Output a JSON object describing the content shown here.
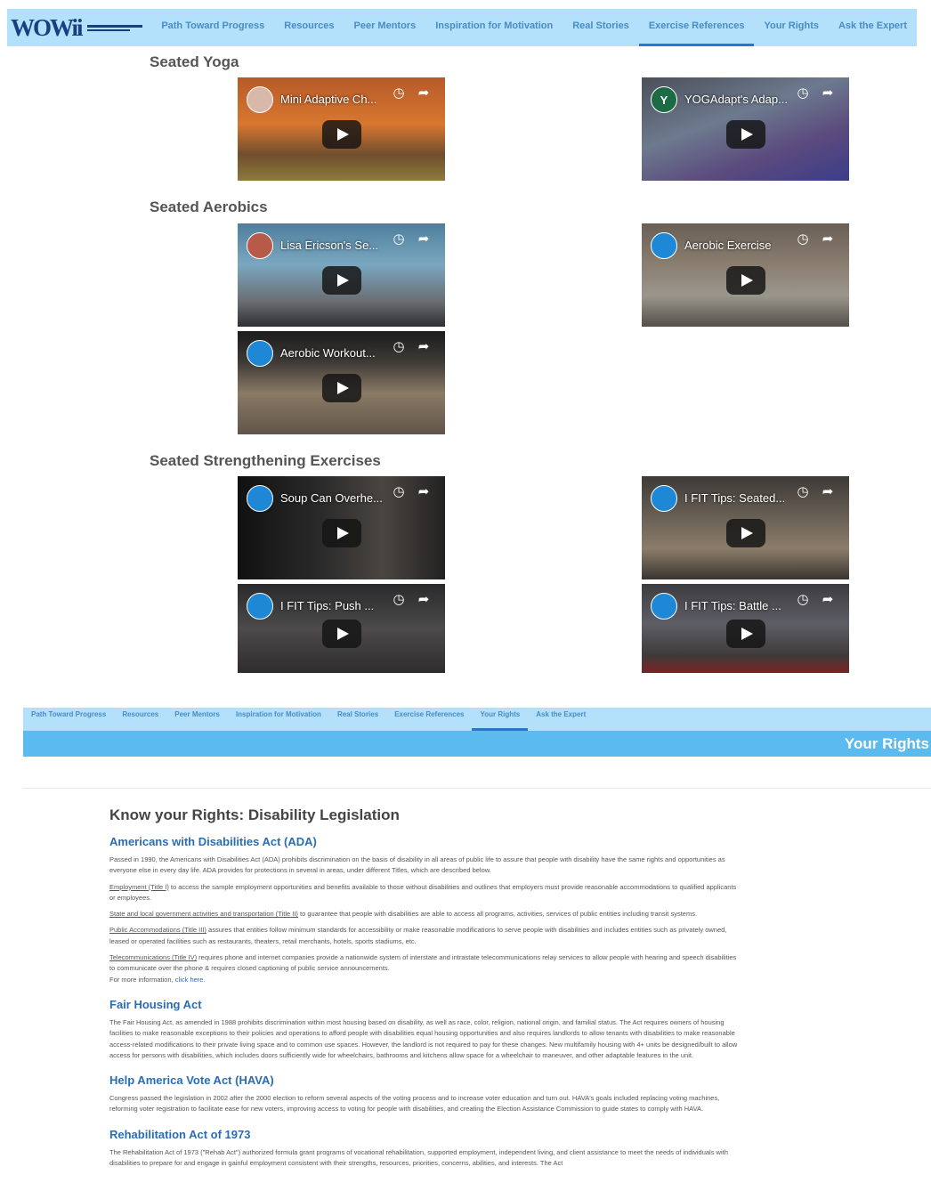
{
  "nav": {
    "logo_text": "WOWii",
    "items": [
      {
        "label": "Path Toward Progress"
      },
      {
        "label": "Resources"
      },
      {
        "label": "Peer Mentors"
      },
      {
        "label": "Inspiration for Motivation"
      },
      {
        "label": "Real Stories"
      },
      {
        "label": "Exercise References"
      },
      {
        "label": "Your Rights"
      },
      {
        "label": "Ask the Expert"
      }
    ],
    "active": "Exercise References"
  },
  "sections": {
    "yoga": {
      "title": "Seated Yoga"
    },
    "aerobics": {
      "title": "Seated Aerobics"
    },
    "strength": {
      "title": "Seated Strengthening Exercises"
    }
  },
  "videos": {
    "yoga_1": {
      "title": "Mini Adaptive Ch...",
      "avatar": ""
    },
    "yoga_2": {
      "title": "YOGAdapt's Adap...",
      "avatar": "Y"
    },
    "aero_1": {
      "title": "Lisa Ericson's Se...",
      "avatar": ""
    },
    "aero_2": {
      "title": "Aerobic Exercise",
      "avatar": ""
    },
    "aero_3": {
      "title": "Aerobic Workout...",
      "avatar": ""
    },
    "str_1": {
      "title": "Soup Can Overhe...",
      "avatar": ""
    },
    "str_2": {
      "title": "I FIT Tips: Seated...",
      "avatar": ""
    },
    "str_3": {
      "title": "I FIT Tips: Push ...",
      "avatar": ""
    },
    "str_4": {
      "title": "I FIT Tips: Battle ...",
      "avatar": ""
    }
  },
  "subnav": {
    "items": [
      {
        "label": "Path Toward Progress"
      },
      {
        "label": "Resources"
      },
      {
        "label": "Peer Mentors"
      },
      {
        "label": "Inspiration for Motivation"
      },
      {
        "label": "Real Stories"
      },
      {
        "label": "Exercise References"
      },
      {
        "label": "Your Rights"
      },
      {
        "label": "Ask the Expert"
      }
    ],
    "active": "Your Rights",
    "banner_title": "Your Rights"
  },
  "rights": {
    "heading": "Know your Rights: Disability Legislation",
    "ada": {
      "title": "Americans with Disabilities Act (ADA)",
      "intro": "Passed in 1990, the Americans with Disabilities Act (ADA) prohibits discrimination on the basis of disability in all areas of public life to assure that people with disability have the same rights and opportunities as everyone else in every day life. ADA provides for protections in several in areas, under different Titles, which are described below.",
      "t1_link": "Employment (Title I)",
      "t1_text": " to access the sample employment opportunities and benefits available to those without disabilities and outlines that employers must provide reasonable accommodations to qualified applicants or employees.",
      "t2_link": "State and local government activities and transportation (Title II)",
      "t2_text": " to guarantee that people with disabilities are able to access all programs, activities, services of public entities including transit systems.",
      "t3_link": "Public Accommodations (Title III)",
      "t3_text": " assures that entities follow minimum standards for accessibility or make reasonable modifications to serve people with disabilities and includes entities such as privately owned, leased or operated facilities such as restaurants, theaters, retail merchants, hotels, sports stadiums, etc.",
      "t4_link": "Telecommunications (Title IV)",
      "t4_text": " requires phone and internet companies provide a nationwide system of interstate and intrastate telecommunications relay services to allow people with hearing and speech disabilities to communicate over the phone & requires closed captioning of public service announcements.",
      "more_prefix": "For more information, ",
      "more_link": "click here."
    },
    "fha": {
      "title": "Fair Housing Act",
      "text": "The Fair Housing Act, as amended in 1988 prohibits discrimination within most housing based on disability, as well as race, color, religion, national origin, and familial status. The Act requires owners of housing facilities to make reasonable exceptions to their policies and operations to afford people with disabilities equal housing opportunities and also requires landlords to allow tenants with disabilities to make reasonable access-related modifications to their private living space and to common use spaces. However, the landlord is not required to pay for these changes. New multifamily housing with 4+ units be designed/built to allow access for persons with disabilities, which includes doors sufficiently wide for wheelchairs, bathrooms and kitchens allow space for a wheelchair to maneuver, and other adaptable features in the unit."
    },
    "hava": {
      "title": "Help America Vote Act (HAVA)",
      "text": "Congress passed the legislation in 2002 after the 2000 election to reform several aspects of the voting process and to increase voter education and turn out. HAVA's goals included replacing voting machines, reforming voter registration to facilitate ease for new voters, improving access to voting for people with disabilities, and creating the Election Assistance Commission to guide states to comply with HAVA."
    },
    "rehab": {
      "title": "Rehabilitation Act of 1973",
      "text": "The Rehabilitation Act of 1973 (\"Rehab Act\") authorized formula grant programs of vocational rehabilitation, supported employment, independent living, and client assistance to meet the needs of individuals with disabilities to prepare for and engage in gainful employment consistent with their strengths, resources, priorities, concerns, abilities, and interests. The Act"
    }
  }
}
